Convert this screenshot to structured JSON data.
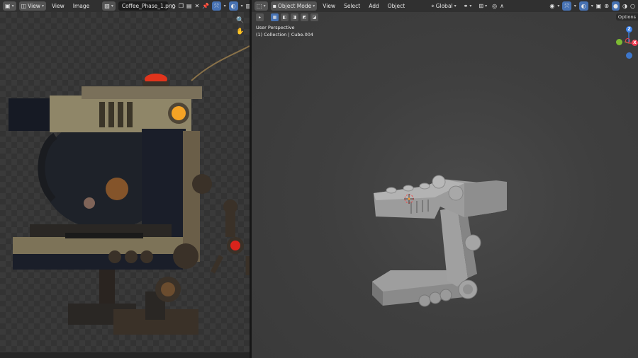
{
  "image_editor": {
    "view_menu": "View",
    "menus": [
      "View",
      "Image"
    ],
    "image_name": "Coffee_Phase_1.png"
  },
  "viewport": {
    "mode": "Object Mode",
    "menus": [
      "View",
      "Select",
      "Add",
      "Object"
    ],
    "orientation": "Global",
    "options_label": "Options",
    "overlay_line1": "User Perspective",
    "overlay_line2": "(1) Collection | Cube.004",
    "axes": {
      "x": "X",
      "y": "Y",
      "z": "Z"
    }
  },
  "colors": {
    "accent_blue": "#4772b3",
    "axis_x": "#ee3d52",
    "axis_y": "#7dbb33",
    "axis_z": "#3d84ee"
  }
}
